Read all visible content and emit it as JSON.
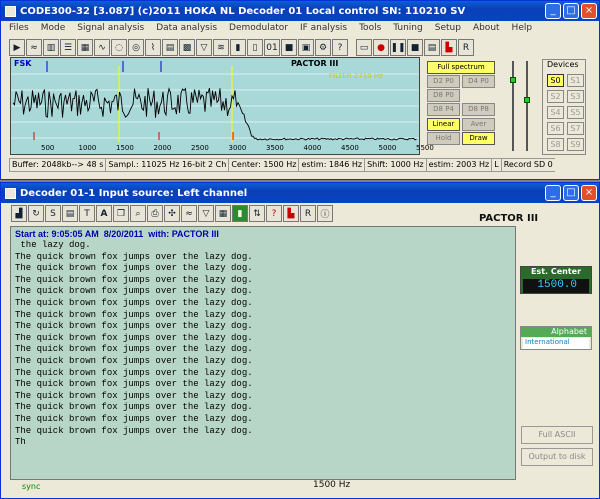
{
  "win1": {
    "title": "CODE300-32 [3.087] (c)2011 HOKA NL    Decoder 01      Local control    SN: 110210 SV",
    "menu": [
      "Files",
      "Mode",
      "Signal analysis",
      "Data analysis",
      "Demodulator",
      "IF analysis",
      "Tools",
      "Tuning",
      "Setup",
      "About",
      "Help"
    ],
    "spectrum": {
      "mode_label": "FSK",
      "signal_label": "PACTOR III",
      "filter_label": "FILTER 2710 Hz",
      "x_ticks": [
        "500",
        "1000",
        "1500",
        "2000",
        "2500",
        "3000",
        "3500",
        "4000",
        "4500",
        "5000",
        "5500"
      ]
    },
    "controls": {
      "full_spectrum": "Full spectrum",
      "d2p0": "D2 P0",
      "d4p0": "D4 P0",
      "d8p0": "D8 P0",
      "d8p4": "D8 P4",
      "d8p8": "D8 P8",
      "linear": "Linear",
      "aver": "Aver",
      "hold": "Hold",
      "draw": "Draw"
    },
    "devices": {
      "label": "Devices",
      "items": [
        "S0",
        "S1",
        "S2",
        "S3",
        "S4",
        "S5",
        "S6",
        "S7",
        "S8",
        "S9"
      ]
    },
    "status": [
      "Buffer: 2048kb--> 48 s",
      "Sampl.: 11025 Hz 16-bit 2 Ch",
      "Center: 1500 Hz",
      "estim: 1846 Hz",
      "Shift: 1000 Hz",
      "estim: 2003 Hz",
      "L",
      "Record  SD 0"
    ]
  },
  "win2": {
    "title": "Decoder 01-1        Input source: Left channel",
    "mode_label": "PACTOR III",
    "header": "Start at: 9:05:05 AM  8/20/2011  with: PACTOR III",
    "lines": [
      " the lazy dog.",
      "The quick brown fox jumps over the lazy dog.",
      "The quick brown fox jumps over the lazy dog.",
      "The quick brown fox jumps over the lazy dog.",
      "The quick brown fox jumps over the lazy dog.",
      "The quick brown fox jumps over the lazy dog.",
      "The quick brown fox jumps over the lazy dog.",
      "The quick brown fox jumps over the lazy dog.",
      "The quick brown fox jumps over the lazy dog.",
      "The quick brown fox jumps over the lazy dog.",
      "The quick brown fox jumps over the lazy dog.",
      "The quick brown fox jumps over the lazy dog.",
      "The quick brown fox jumps over the lazy dog.",
      "The quick brown fox jumps over the lazy dog.",
      "The quick brown fox jumps over the lazy dog.",
      "The quick brown fox jumps over the lazy dog.",
      "The quick brown fox jumps over the lazy dog.",
      "Th"
    ],
    "est_center_label": "Est. Center",
    "est_center_value": "1500.0",
    "alphabet_label": "Alphabet",
    "alphabet_value": "International",
    "full_ascii": "Full ASCII",
    "output_to_disk": "Output to disk",
    "sync_label": "sync",
    "freq_label": "1500 Hz"
  }
}
